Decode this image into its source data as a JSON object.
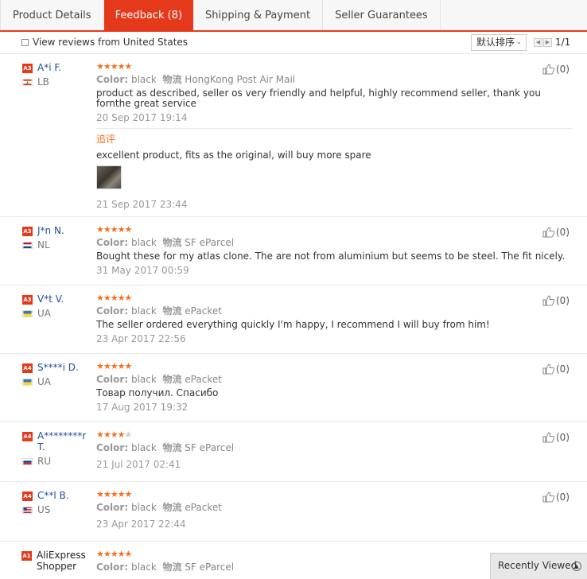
{
  "tabs": [
    {
      "label": "Product Details"
    },
    {
      "label": "Feedback (8)"
    },
    {
      "label": "Shipping & Payment"
    },
    {
      "label": "Seller Guarantees"
    }
  ],
  "toolbar": {
    "filter_label": "View reviews from United States",
    "sort_value": "默认排序",
    "page_indicator": "1/1"
  },
  "reviews": [
    {
      "level": "A3",
      "name": "A*i F.",
      "country": "LB",
      "rating": 5,
      "color_label": "Color:",
      "color": "black",
      "ship_label": "物流",
      "shipping": "HongKong Post Air Mail",
      "text": "product as described, seller os very friendly and helpful, highly recommend seller, thank you fornthe great service",
      "date": "20 Sep 2017 19:14",
      "helpful": "(0)",
      "additional": {
        "title": "追评",
        "text": "excellent product, fits as the original, will buy more spare",
        "date": "21 Sep 2017 23:44"
      }
    },
    {
      "level": "A3",
      "name": "J*n N.",
      "country": "NL",
      "rating": 5,
      "color_label": "Color:",
      "color": "black",
      "ship_label": "物流",
      "shipping": "SF eParcel",
      "text": "Bought these for my atlas clone. The are not from aluminium but seems to be steel. The fit nicely.",
      "date": "31 May 2017 00:59",
      "helpful": "(0)"
    },
    {
      "level": "A3",
      "name": "V*t V.",
      "country": "UA",
      "rating": 5,
      "color_label": "Color:",
      "color": "black",
      "ship_label": "物流",
      "shipping": "ePacket",
      "text": "The seller ordered everything quickly I'm happy, I recommend I will buy from him!",
      "date": "23 Apr 2017 22:56",
      "helpful": "(0)"
    },
    {
      "level": "A4",
      "name": "S****i D.",
      "country": "UA",
      "rating": 5,
      "color_label": "Color:",
      "color": "black",
      "ship_label": "物流",
      "shipping": "ePacket",
      "text": "Товар получил. Спасибо",
      "date": "17 Aug 2017 19:32",
      "helpful": "(0)"
    },
    {
      "level": "A4",
      "name": "A********r T.",
      "country": "RU",
      "rating": 4,
      "color_label": "Color:",
      "color": "black",
      "ship_label": "物流",
      "shipping": "SF eParcel",
      "text": "",
      "date": "21 Jul 2017 02:41",
      "helpful": "(0)"
    },
    {
      "level": "A4",
      "name": "C**l B.",
      "country": "US",
      "rating": 5,
      "color_label": "Color:",
      "color": "black",
      "ship_label": "物流",
      "shipping": "ePacket",
      "text": "",
      "date": "23 Apr 2017 22:44",
      "helpful": "(0)"
    },
    {
      "level": "A1",
      "name": "AliExpress Shopper",
      "country": "",
      "rating": 5,
      "color_label": "Color:",
      "color": "black",
      "ship_label": "物流",
      "shipping": "SF eParcel",
      "text": "",
      "date": "",
      "helpful": ""
    }
  ],
  "recently_viewed": {
    "label": "Recently Viewed",
    "icon": "chevron-up-icon"
  },
  "colors": {
    "accent": "#e5391c",
    "star": "#f37021",
    "link": "#1f4f9a"
  }
}
